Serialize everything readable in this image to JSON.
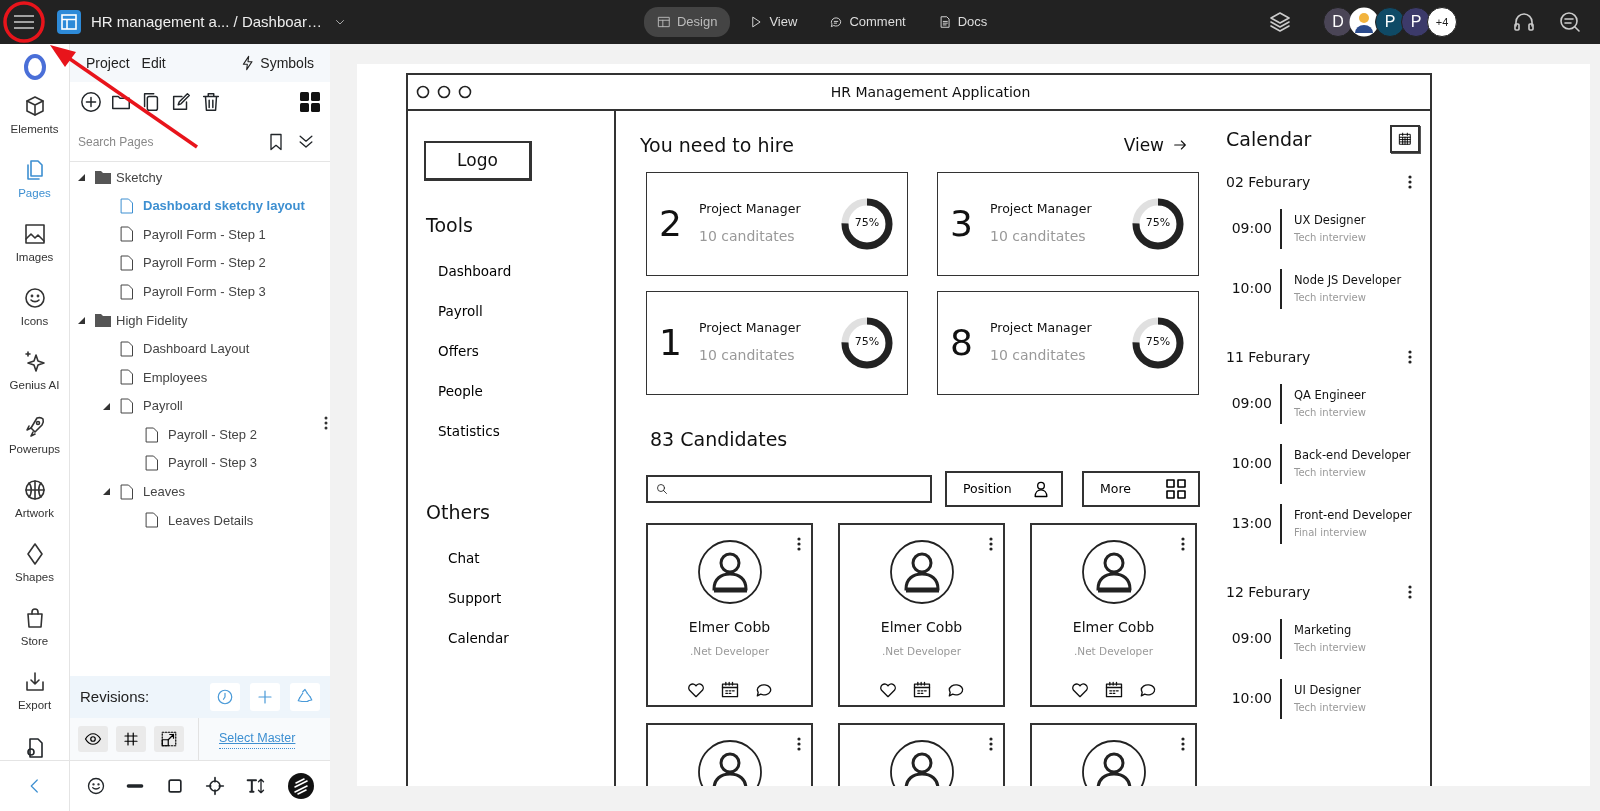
{
  "topbar": {
    "breadcrumb": "HR management a... / Dashboar…",
    "modes": [
      {
        "label": "Design",
        "selected": true
      },
      {
        "label": "View",
        "selected": false
      },
      {
        "label": "Comment",
        "selected": false
      },
      {
        "label": "Docs",
        "selected": false
      }
    ],
    "avatars": [
      {
        "kind": "initial",
        "initial": "D",
        "color": "#4a4556"
      },
      {
        "kind": "picture"
      },
      {
        "kind": "initial",
        "initial": "P",
        "color": "#0f4a66"
      },
      {
        "kind": "initial",
        "initial": "P",
        "color": "#3c3a6a"
      },
      {
        "kind": "count",
        "initial": "+4"
      }
    ]
  },
  "rail": [
    {
      "label": "Elements",
      "selected": false
    },
    {
      "label": "Pages",
      "selected": true
    },
    {
      "label": "Images",
      "selected": false
    },
    {
      "label": "Icons",
      "selected": false
    },
    {
      "label": "Genius AI",
      "selected": false
    },
    {
      "label": "Powerups",
      "selected": false
    },
    {
      "label": "Artwork",
      "selected": false
    },
    {
      "label": "Shapes",
      "selected": false
    },
    {
      "label": "Store",
      "selected": false
    },
    {
      "label": "Export",
      "selected": false
    }
  ],
  "panel": {
    "menus": [
      "Project",
      "Edit"
    ],
    "symbols": "Symbols",
    "search": {
      "placeholder": "Search Pages"
    },
    "tree": [
      {
        "label": "Sketchy",
        "kind": "folder",
        "expanded": true,
        "selected": false,
        "children": [
          {
            "label": "Dashboard sketchy layout",
            "kind": "page",
            "selected": true
          },
          {
            "label": "Payroll Form - Step 1",
            "kind": "page",
            "selected": false
          },
          {
            "label": "Payroll Form - Step 2",
            "kind": "page",
            "selected": false
          },
          {
            "label": "Payroll Form - Step 3",
            "kind": "page",
            "selected": false
          }
        ]
      },
      {
        "label": "High Fidelity",
        "kind": "folder",
        "expanded": true,
        "selected": false,
        "children": [
          {
            "label": "Dashboard Layout",
            "kind": "page",
            "selected": false
          },
          {
            "label": "Employees",
            "kind": "page",
            "selected": false
          },
          {
            "label": "Payroll",
            "kind": "page",
            "expanded": true,
            "selected": false,
            "children": [
              {
                "label": "Payroll - Step 2",
                "kind": "page",
                "selected": false
              },
              {
                "label": "Payroll - Step 3",
                "kind": "page",
                "selected": false
              }
            ]
          },
          {
            "label": "Leaves",
            "kind": "page",
            "expanded": true,
            "selected": false,
            "children": [
              {
                "label": "Leaves Details",
                "kind": "page",
                "selected": false
              }
            ]
          }
        ]
      }
    ],
    "revisions": "Revisions:",
    "select_master": "Select Master"
  },
  "mockup": {
    "title": "HR Management Application",
    "logo": "Logo",
    "nav_sections": [
      {
        "heading": "Tools",
        "items": [
          "Dashboard",
          "Payroll",
          "Offers",
          "People",
          "Statistics"
        ]
      },
      {
        "heading": "Others",
        "items": [
          "Chat",
          "Support",
          "Calendar"
        ]
      }
    ],
    "hire": {
      "heading": "You need to hire",
      "view": "View",
      "cards": [
        {
          "number": "2",
          "role": "Project Manager",
          "subtitle": "10 canditates",
          "percent": "75%",
          "level": 0.75
        },
        {
          "number": "3",
          "role": "Project Manager",
          "subtitle": "10 canditates",
          "percent": "75%",
          "level": 0.75
        },
        {
          "number": "1",
          "role": "Project Manager",
          "subtitle": "10 canditates",
          "percent": "75%",
          "level": 0.75
        },
        {
          "number": "8",
          "role": "Project Manager",
          "subtitle": "10 canditates",
          "percent": "75%",
          "level": 0.75
        }
      ]
    },
    "candidates": {
      "heading": "83 Candidates",
      "filters": [
        "Position",
        "More"
      ],
      "cards": [
        {
          "kind": "full",
          "name": "Elmer Cobb",
          "role": ".Net Developer"
        },
        {
          "kind": "full",
          "name": "Elmer Cobb",
          "role": ".Net Developer"
        },
        {
          "kind": "full",
          "name": "Elmer Cobb",
          "role": ".Net Developer"
        },
        {
          "kind": "cut"
        },
        {
          "kind": "cut"
        },
        {
          "kind": "cut"
        }
      ]
    },
    "calendar": {
      "title": "Calendar",
      "days": [
        {
          "date": "02 Feburary",
          "events": [
            {
              "time": "09:00",
              "title": "UX Designer",
              "note": "Tech interview"
            },
            {
              "time": "10:00",
              "title": "Node JS Developer",
              "note": "Tech interview"
            }
          ]
        },
        {
          "date": "11 Feburary",
          "events": [
            {
              "time": "09:00",
              "title": "QA Engineer",
              "note": "Tech interview"
            },
            {
              "time": "10:00",
              "title": "Back-end Developer",
              "note": "Tech interview"
            },
            {
              "time": "13:00",
              "title": "Front-end Developer",
              "note": "Final interview"
            }
          ]
        },
        {
          "date": "12 Feburary",
          "events": [
            {
              "time": "09:00",
              "title": "Marketing",
              "note": "Tech interview"
            },
            {
              "time": "10:00",
              "title": "UI Designer",
              "note": "Tech interview"
            }
          ]
        }
      ]
    }
  }
}
